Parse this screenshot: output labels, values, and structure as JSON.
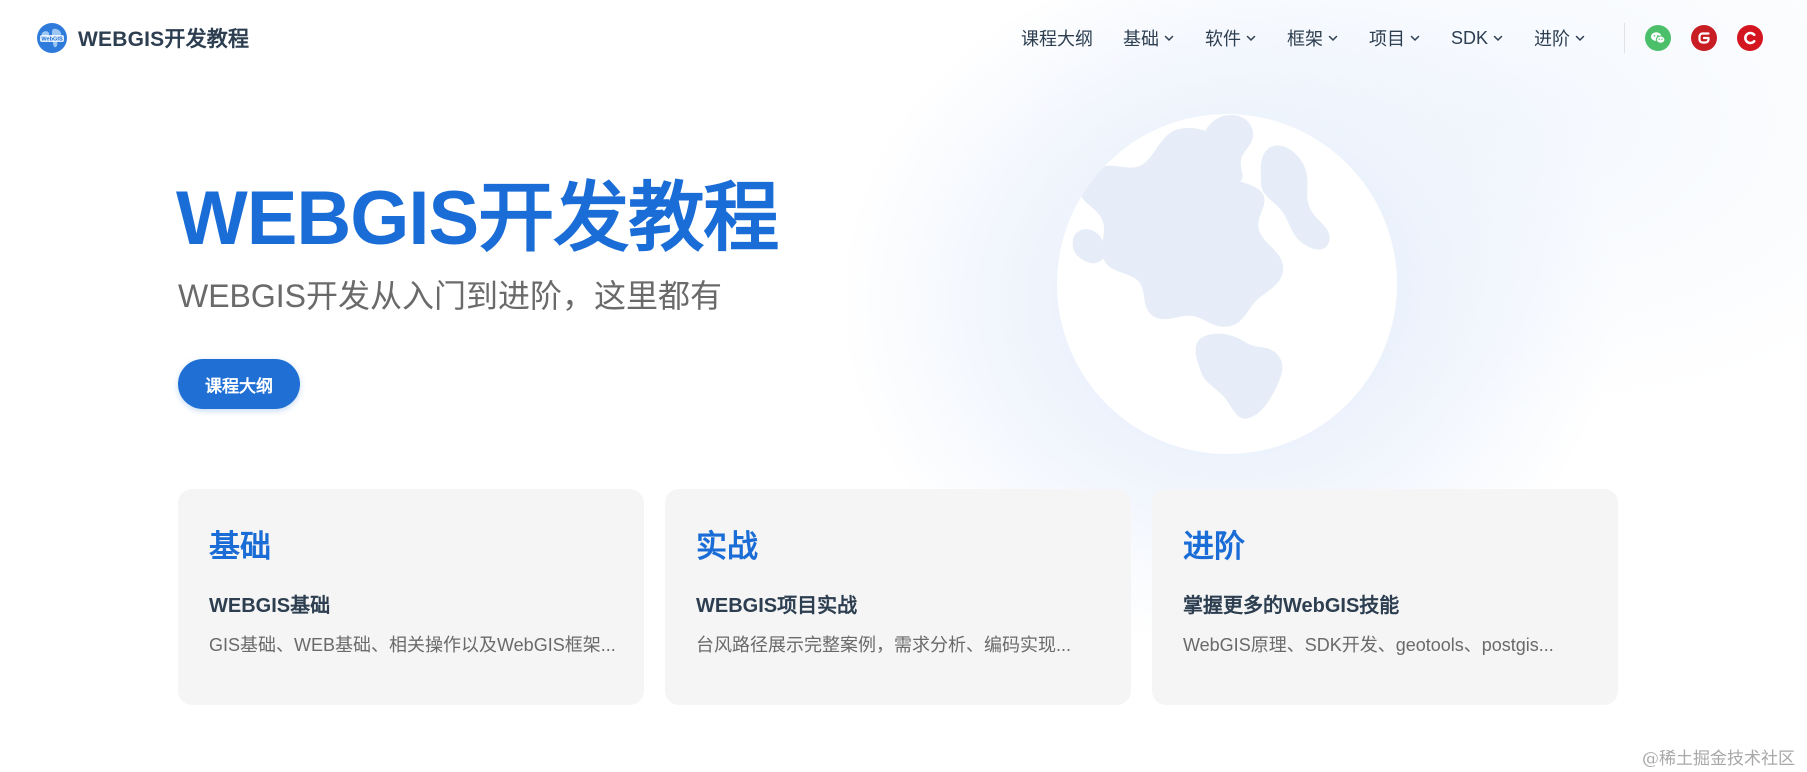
{
  "brand": {
    "name": "WEBGIS开发教程",
    "logo_icon": "globe-logo-icon",
    "logo_text": "WebGIS"
  },
  "nav": {
    "items": [
      {
        "label": "课程大纲",
        "has_dropdown": false
      },
      {
        "label": "基础",
        "has_dropdown": true
      },
      {
        "label": "软件",
        "has_dropdown": true
      },
      {
        "label": "框架",
        "has_dropdown": true
      },
      {
        "label": "项目",
        "has_dropdown": true
      },
      {
        "label": "SDK",
        "has_dropdown": true
      },
      {
        "label": "进阶",
        "has_dropdown": true
      }
    ],
    "social": [
      {
        "icon": "wechat-icon",
        "color": "#4cbf6b"
      },
      {
        "icon": "gitee-icon",
        "color": "#c71d23"
      },
      {
        "icon": "csdn-icon",
        "color": "#d4141e"
      }
    ]
  },
  "hero": {
    "title": "WEBGIS开发教程",
    "tagline": "WEBGIS开发从入门到进阶，这里都有",
    "action_label": "课程大纲",
    "illustration": "globe-icon"
  },
  "features": [
    {
      "title": "基础",
      "subtitle": "WEBGIS基础",
      "desc": "GIS基础、WEB基础、相关操作以及WebGIS框架..."
    },
    {
      "title": "实战",
      "subtitle": "WEBGIS项目实战",
      "desc": "台风路径展示完整案例，需求分析、编码实现..."
    },
    {
      "title": "进阶",
      "subtitle": "掌握更多的WebGIS技能",
      "desc": "WebGIS原理、SDK开发、geotools、postgis..."
    }
  ],
  "watermark": "@稀土掘金技术社区",
  "colors": {
    "accent": "#1a6dd6",
    "button": "#1f6fd4",
    "card_bg": "#f5f5f5",
    "text": "#2c3e50",
    "muted": "#6a6a6a"
  }
}
